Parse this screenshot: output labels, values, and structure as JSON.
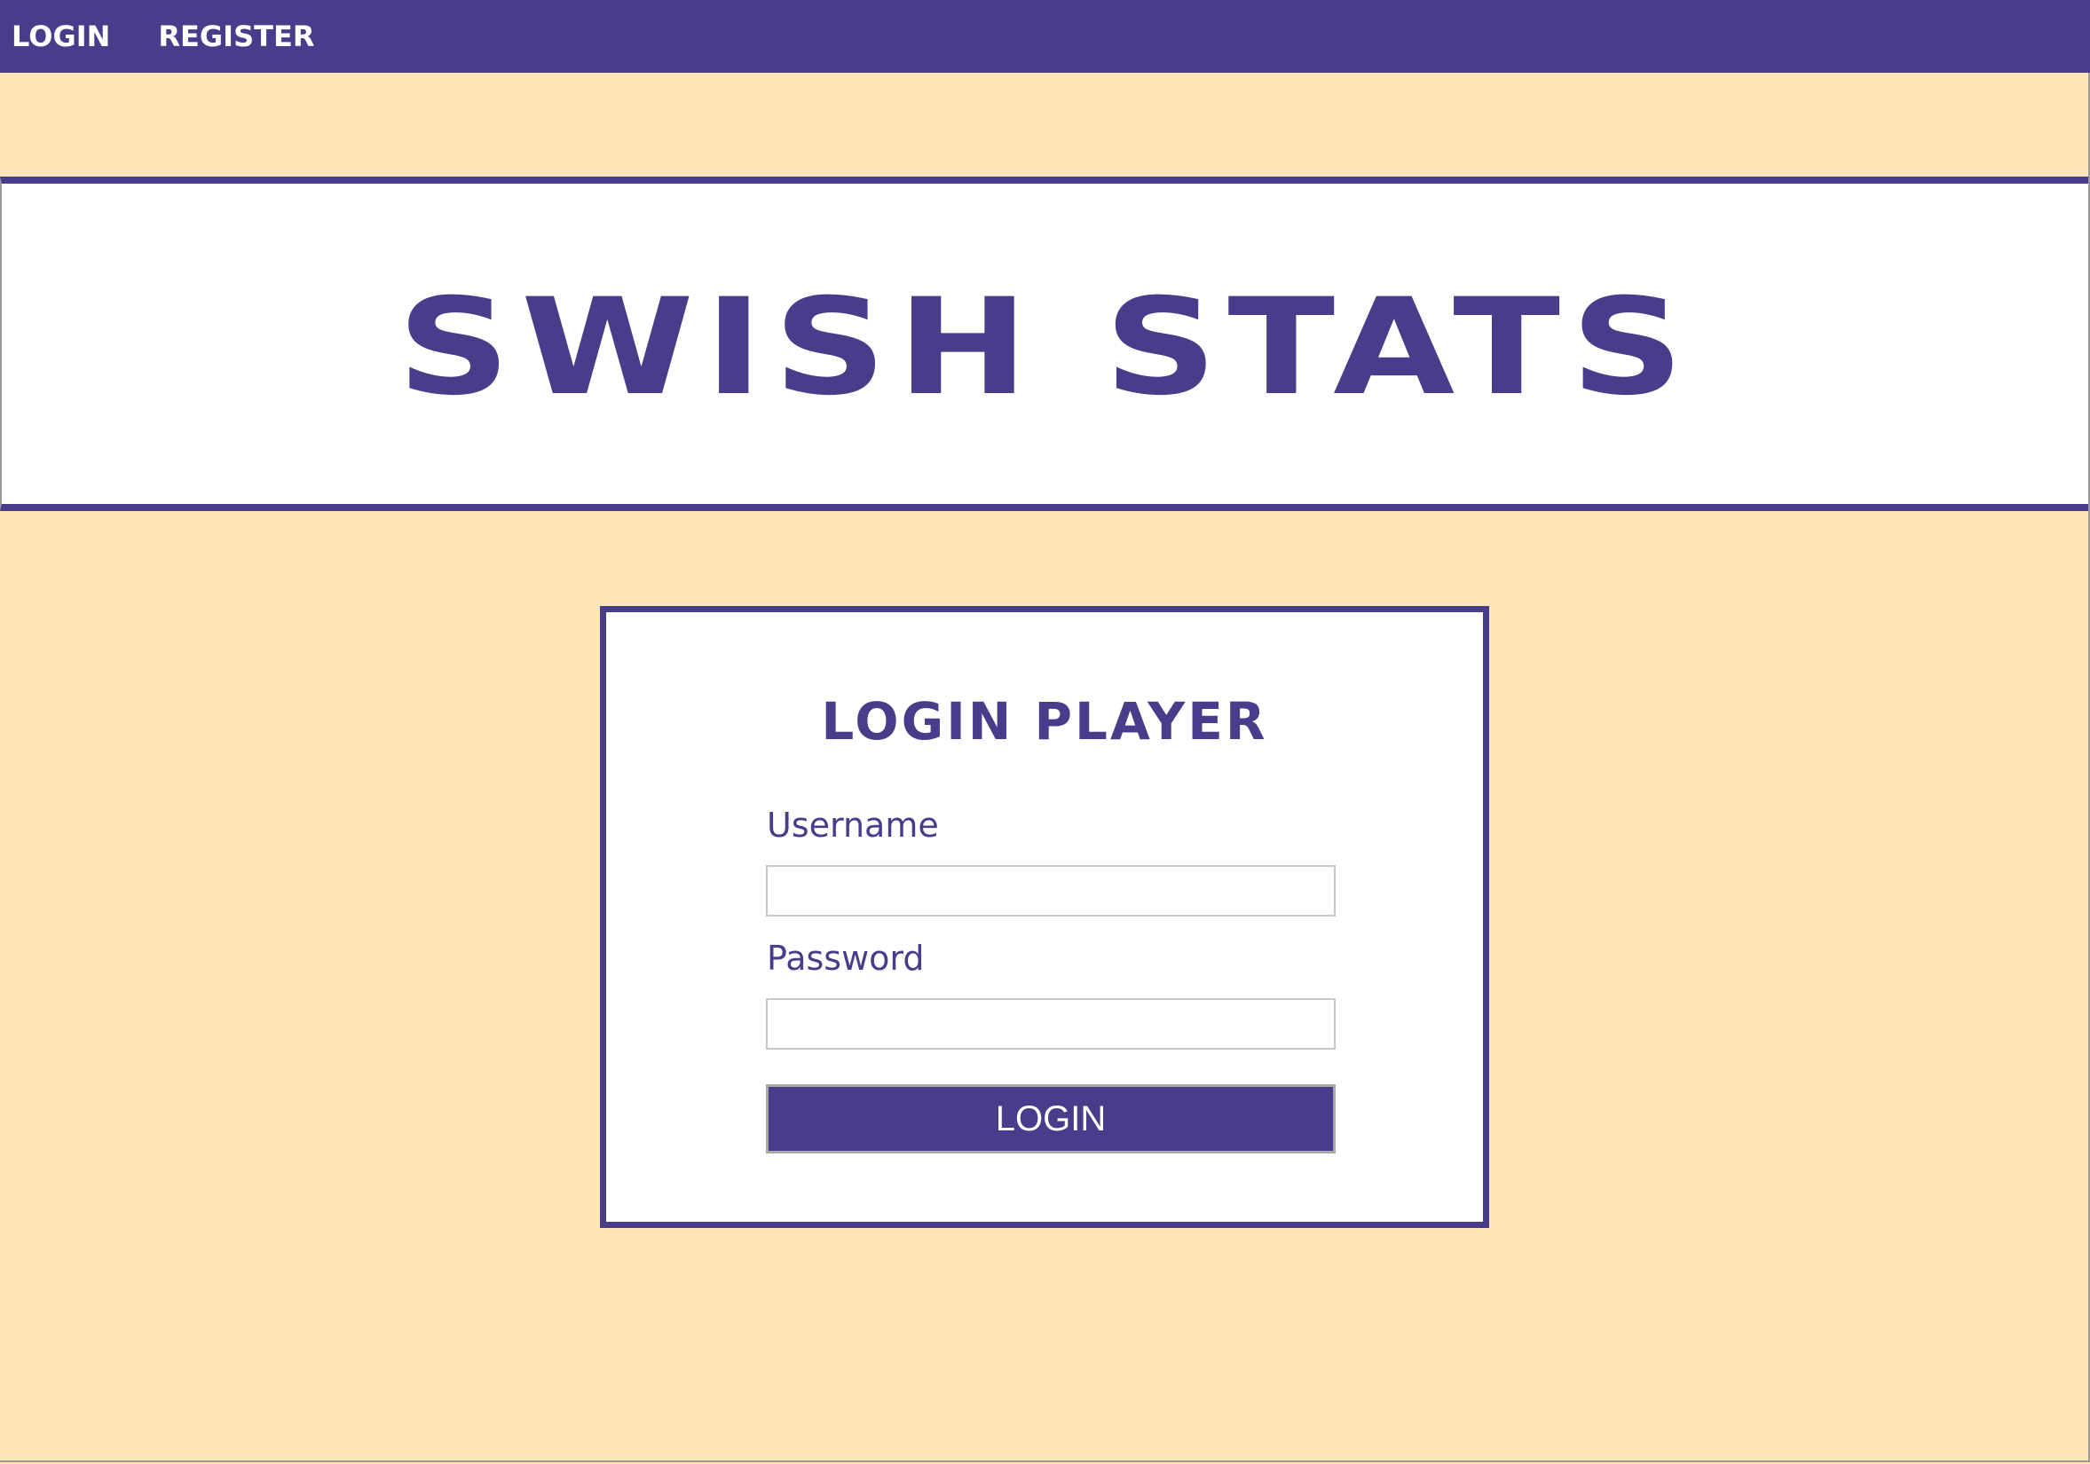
{
  "nav": {
    "items": [
      {
        "label": "LOGIN"
      },
      {
        "label": "REGISTER"
      }
    ]
  },
  "banner": {
    "title": "SWISH STATS"
  },
  "login_form": {
    "title": "LOGIN PLAYER",
    "username_label": "Username",
    "username_value": "",
    "password_label": "Password",
    "password_value": "",
    "submit_label": "LOGIN"
  },
  "colors": {
    "primary": "#483D8B",
    "background": "#FFE4B5",
    "card": "#FFFFFF"
  }
}
